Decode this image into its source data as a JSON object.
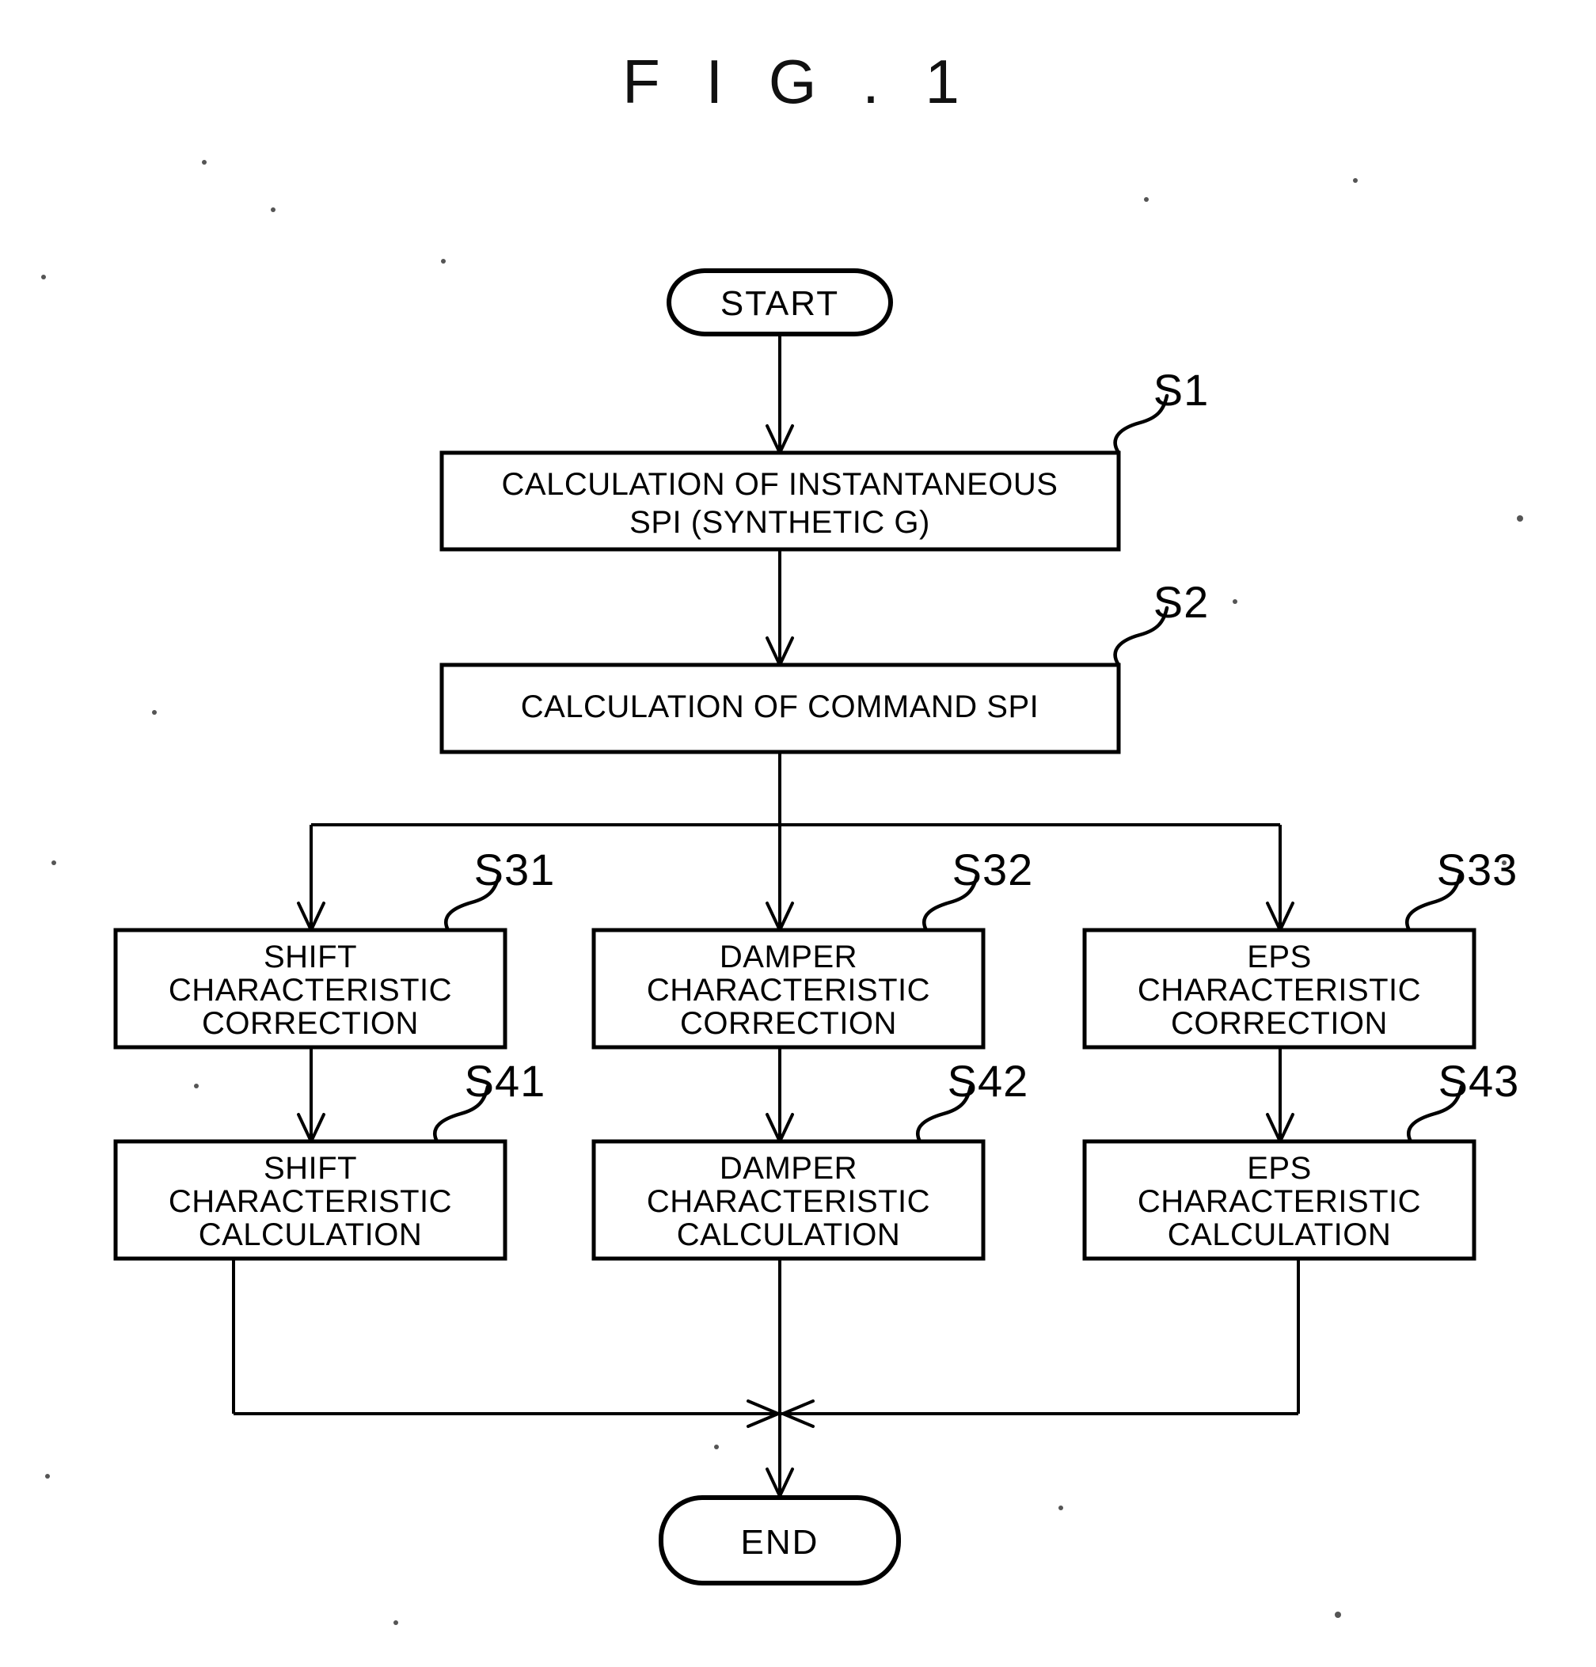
{
  "figure": {
    "title": "F I G . 1",
    "type": "flowchart"
  },
  "nodes": {
    "start": {
      "label": "START",
      "shape": "terminator"
    },
    "end": {
      "label": "END",
      "shape": "terminator"
    },
    "s1": {
      "step": "S1",
      "line1": "CALCULATION OF INSTANTANEOUS",
      "line2": "SPI (SYNTHETIC G)"
    },
    "s2": {
      "step": "S2",
      "line1": "CALCULATION OF COMMAND SPI"
    },
    "s31": {
      "step": "S31",
      "line1": "SHIFT",
      "line2": "CHARACTERISTIC",
      "line3": "CORRECTION"
    },
    "s32": {
      "step": "S32",
      "line1": "DAMPER",
      "line2": "CHARACTERISTIC",
      "line3": "CORRECTION"
    },
    "s33": {
      "step": "S33",
      "line1": "EPS",
      "line2": "CHARACTERISTIC",
      "line3": "CORRECTION"
    },
    "s41": {
      "step": "S41",
      "line1": "SHIFT",
      "line2": "CHARACTERISTIC",
      "line3": "CALCULATION"
    },
    "s42": {
      "step": "S42",
      "line1": "DAMPER",
      "line2": "CHARACTERISTIC",
      "line3": "CALCULATION"
    },
    "s43": {
      "step": "S43",
      "line1": "EPS",
      "line2": "CHARACTERISTIC",
      "line3": "CALCULATION"
    }
  },
  "colors": {
    "ink": "#000000",
    "paper": "#ffffff"
  }
}
